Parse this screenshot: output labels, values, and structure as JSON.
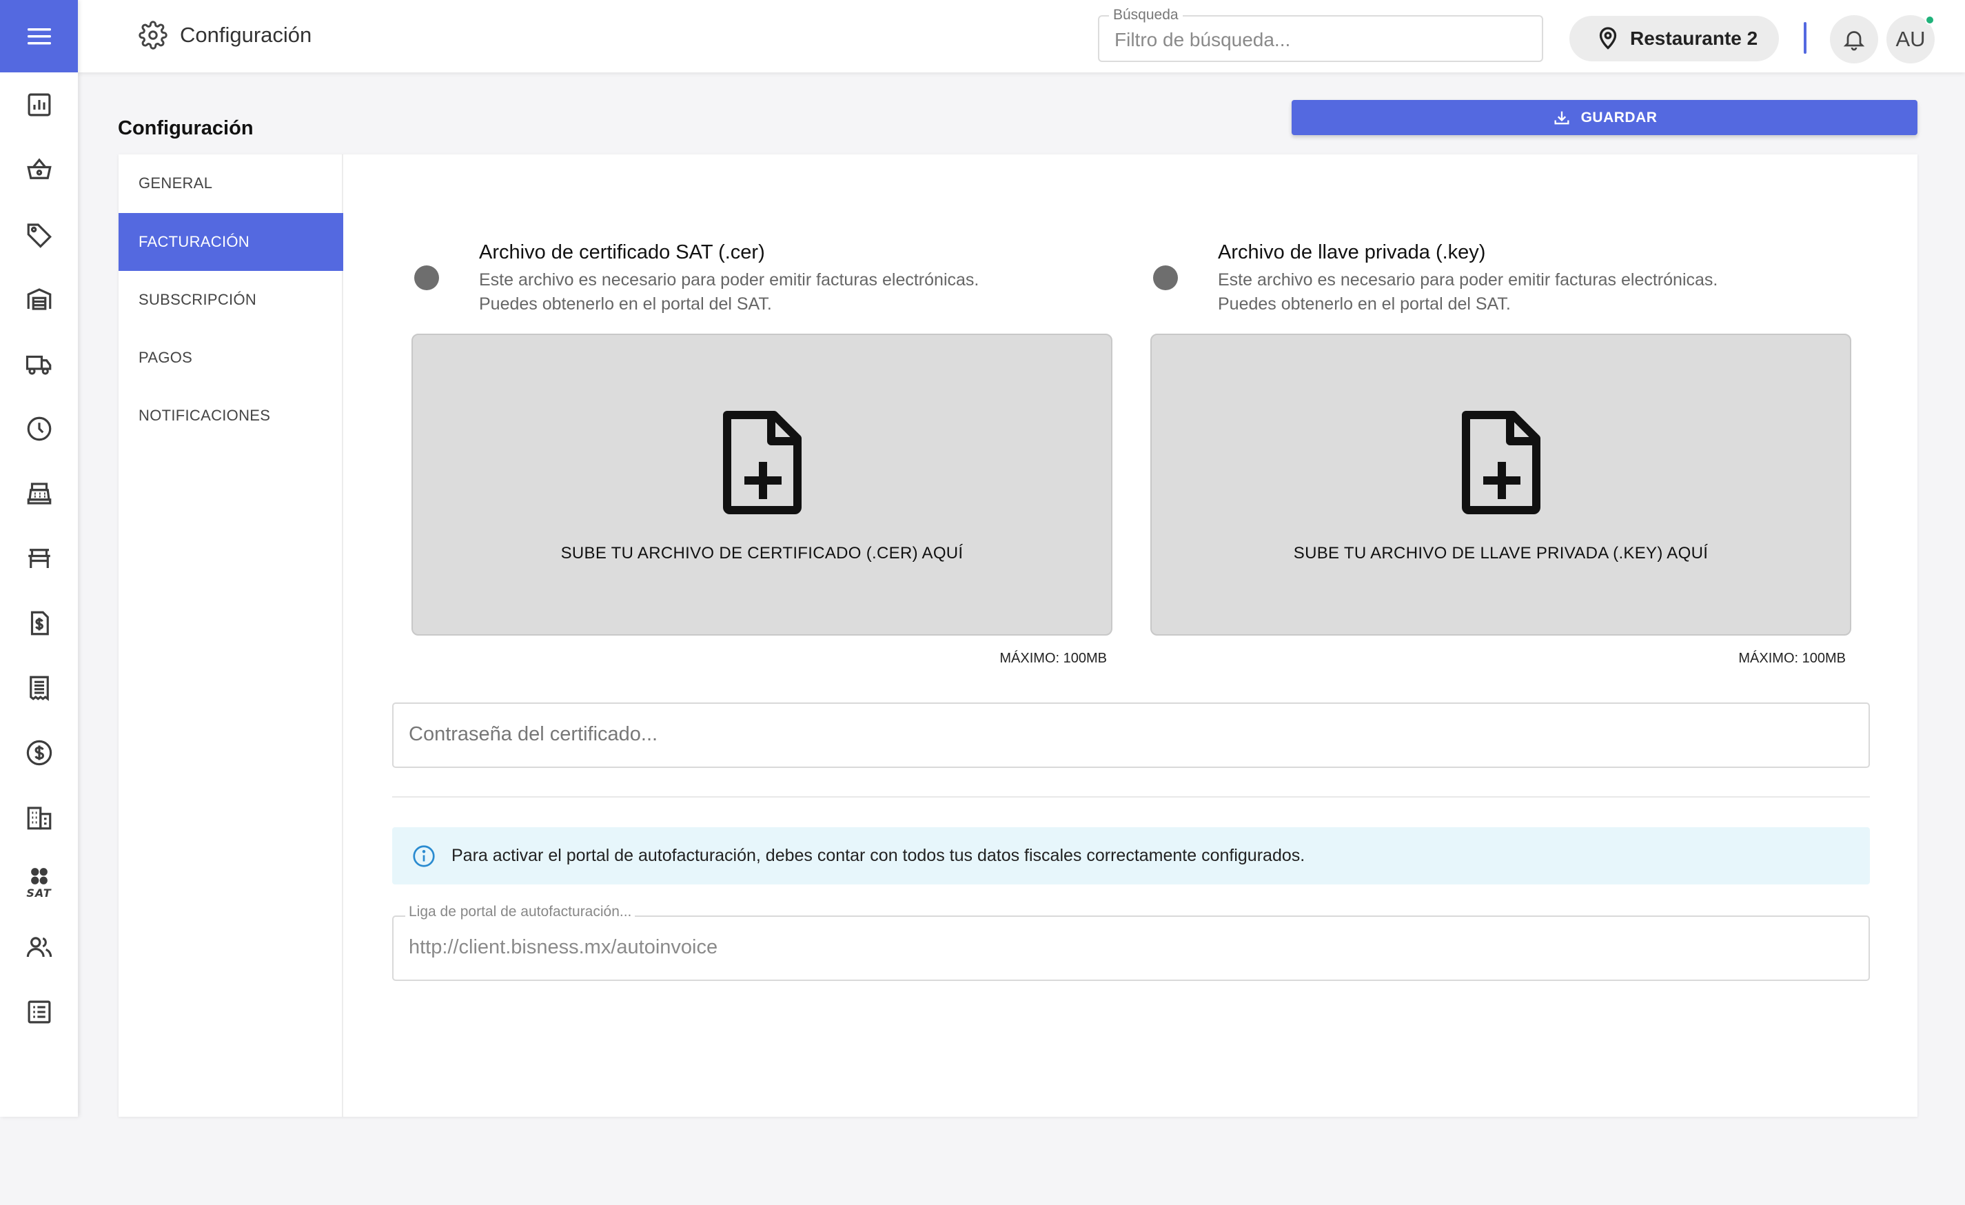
{
  "topbar": {
    "title": "Configuración",
    "search_label": "Búsqueda",
    "search_placeholder": "Filtro de búsqueda...",
    "location": "Restaurante 2",
    "avatar_initials": "AU"
  },
  "sidebar": {
    "items": [
      {
        "name": "dashboard",
        "icon": "bar-chart-icon"
      },
      {
        "name": "sales",
        "icon": "basket-icon"
      },
      {
        "name": "products",
        "icon": "tag-icon"
      },
      {
        "name": "warehouse",
        "icon": "warehouse-icon"
      },
      {
        "name": "deliveries",
        "icon": "truck-icon"
      },
      {
        "name": "history",
        "icon": "clock-icon"
      },
      {
        "name": "cash-register",
        "icon": "register-icon"
      },
      {
        "name": "tables",
        "icon": "table-icon"
      },
      {
        "name": "invoices",
        "icon": "invoice-dollar-icon"
      },
      {
        "name": "receipts",
        "icon": "receipt-icon"
      },
      {
        "name": "payments",
        "icon": "dollar-circle-icon"
      },
      {
        "name": "branches",
        "icon": "building-icon"
      },
      {
        "name": "sat",
        "icon": "sat-icon",
        "label": "SAT"
      },
      {
        "name": "users",
        "icon": "users-icon"
      },
      {
        "name": "reports",
        "icon": "list-icon"
      }
    ]
  },
  "page": {
    "title": "Configuración",
    "save_label": "GUARDAR"
  },
  "tabs": [
    {
      "label": "GENERAL",
      "active": false
    },
    {
      "label": "FACTURACIÓN",
      "active": true
    },
    {
      "label": "SUBSCRIPCIÓN",
      "active": false
    },
    {
      "label": "PAGOS",
      "active": false
    },
    {
      "label": "NOTIFICACIONES",
      "active": false
    }
  ],
  "billing": {
    "cer": {
      "title": "Archivo de certificado SAT (.cer)",
      "desc_line1": "Este archivo es necesario para poder emitir facturas electrónicas.",
      "desc_line2": "Puedes obtenerlo en el portal del SAT.",
      "dropzone_text": "SUBE TU ARCHIVO DE CERTIFICADO (.CER) AQUÍ",
      "max_size": "MÁXIMO: 100MB"
    },
    "key": {
      "title": "Archivo de llave privada (.key)",
      "desc_line1": "Este archivo es necesario para poder emitir facturas electrónicas.",
      "desc_line2": "Puedes obtenerlo en el portal del SAT.",
      "dropzone_text": "SUBE TU ARCHIVO DE LLAVE PRIVADA (.KEY) AQUÍ",
      "max_size": "MÁXIMO: 100MB"
    },
    "password_placeholder": "Contraseña del certificado...",
    "info_text": "Para activar el portal de autofacturación, debes contar con todos tus datos fiscales correctamente configurados.",
    "portal_label": "Liga de portal de autofacturación...",
    "portal_placeholder": "http://client.bisness.mx/autoinvoice"
  },
  "colors": {
    "primary": "#5469e0",
    "info_bg": "#e7f6fb",
    "dropzone_bg": "#dcdcdc",
    "status_online": "#1fb27a"
  }
}
